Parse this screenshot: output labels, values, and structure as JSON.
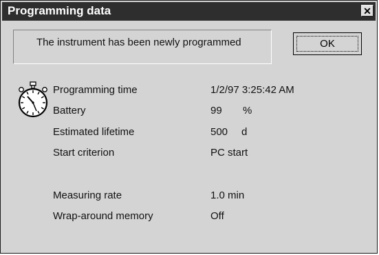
{
  "dialog": {
    "title": "Programming data",
    "close_symbol": "✕",
    "message": "The instrument has been newly programmed",
    "ok_label": "OK"
  },
  "icon": "stopwatch-icon",
  "fields": [
    {
      "label": "Programming time",
      "value": "1/2/97 3:25:42 AM",
      "unit": ""
    },
    {
      "label": "Battery",
      "value": "99",
      "unit": "%"
    },
    {
      "label": "Estimated lifetime",
      "value": "500",
      "unit": "d"
    },
    {
      "label": "Start criterion",
      "value": "PC start",
      "unit": ""
    },
    {
      "label": "Measuring rate",
      "value": "1.0 min",
      "unit": ""
    },
    {
      "label": "Wrap-around memory",
      "value": "Off",
      "unit": ""
    }
  ]
}
